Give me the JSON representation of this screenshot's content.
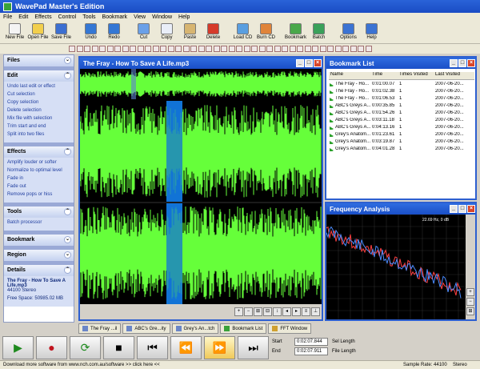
{
  "window": {
    "title": "WavePad Master's Edition"
  },
  "menu": [
    "File",
    "Edit",
    "Effects",
    "Control",
    "Tools",
    "Bookmark",
    "View",
    "Window",
    "Help"
  ],
  "toolbar": [
    {
      "label": "New File",
      "icon": "new-file-icon",
      "color": "#f4f4f4"
    },
    {
      "label": "Open File",
      "icon": "open-folder-icon",
      "color": "#f2cf4d"
    },
    {
      "label": "Save File",
      "icon": "save-disk-icon",
      "color": "#3c6fd1"
    },
    {
      "label": "Undo",
      "icon": "undo-icon",
      "color": "#3477d4"
    },
    {
      "label": "Redo",
      "icon": "redo-icon",
      "color": "#3477d4"
    },
    {
      "label": "Cut",
      "icon": "scissors-icon",
      "color": "#6aa0e8"
    },
    {
      "label": "Copy",
      "icon": "copy-icon",
      "color": "#e9eef8"
    },
    {
      "label": "Paste",
      "icon": "paste-icon",
      "color": "#d7b571"
    },
    {
      "label": "Delete",
      "icon": "delete-x-icon",
      "color": "#d63b2a"
    },
    {
      "label": "Load CD",
      "icon": "load-cd-icon",
      "color": "#5a9fe0"
    },
    {
      "label": "Burn CD",
      "icon": "burn-cd-icon",
      "color": "#e0843a"
    },
    {
      "label": "Bookmark",
      "icon": "bookmark-icon",
      "color": "#4aa84a"
    },
    {
      "label": "Batch",
      "icon": "batch-icon",
      "color": "#3aa15a"
    },
    {
      "label": "Options",
      "icon": "options-gear-icon",
      "color": "#3b73d3"
    },
    {
      "label": "Help",
      "icon": "help-icon",
      "color": "#3b73d3"
    }
  ],
  "sidebar": {
    "files": {
      "title": "Files"
    },
    "edit": {
      "title": "Edit",
      "items": [
        "Undo last edit or effect",
        "Cut selection",
        "Copy selection",
        "Delete selection",
        "Mix file with selection",
        "Trim start and end",
        "Split into two files"
      ]
    },
    "effects": {
      "title": "Effects",
      "items": [
        "Amplify louder or softer",
        "Normalize to optimal level",
        "Fade in",
        "Fade out",
        "Remove pops or hiss"
      ]
    },
    "tools": {
      "title": "Tools",
      "items": [
        "Batch processor"
      ]
    },
    "bookmark": {
      "title": "Bookmark"
    },
    "region": {
      "title": "Region"
    },
    "details": {
      "title": "Details",
      "name": "The Fray - How To Save A Life.mp3",
      "format": "44100 Stereo",
      "free": "Free Space: 50985.02 MB"
    }
  },
  "wave_window": {
    "title": "The Fray - How To Save A Life.mp3",
    "wave_color": "#66ff3a",
    "selection_color": "#1273d6"
  },
  "bookmark_list": {
    "title": "Bookmark List",
    "columns": [
      "Name",
      "Time",
      "Times Visited",
      "Last Visited"
    ],
    "rows": [
      [
        "The Fray - Ho...",
        "0:01:00.07",
        "1",
        "2007-06-20..."
      ],
      [
        "The Fray - Ho...",
        "0:01:02.38",
        "1",
        "2007-06-20..."
      ],
      [
        "The Fray - Ho...",
        "0:01:06.53",
        "1",
        "2007-06-20..."
      ],
      [
        "ABC's Greys A...",
        "0:00:35.85",
        "1",
        "2007-06-20..."
      ],
      [
        "ABC's Greys A...",
        "0:01:54.26",
        "1",
        "2007-06-20..."
      ],
      [
        "ABC's Greys A...",
        "0:03:11.18",
        "1",
        "2007-06-20..."
      ],
      [
        "ABC's Greys A...",
        "0:04:13.16",
        "1",
        "2007-06-20..."
      ],
      [
        "Grey's Anatom...",
        "0:01:23.61",
        "1",
        "2007-06-20..."
      ],
      [
        "Grey's Anatom...",
        "0:03:19.87",
        "1",
        "2007-06-20..."
      ],
      [
        "Grey's Anatom...",
        "0:04:01.28",
        "1",
        "2007-06-20..."
      ]
    ]
  },
  "frequency": {
    "title": "Frequency Analysis",
    "readout": "22.69 Hz, 0 dB"
  },
  "tabs": [
    "The Fray ...il",
    "ABC's Gre...ity",
    "Grey's An...tch",
    "Bookmark List",
    "FFT Window"
  ],
  "transport": [
    "play",
    "record",
    "loop",
    "stop",
    "skip-start",
    "rewind",
    "fast-forward",
    "skip-end"
  ],
  "time": {
    "start_label": "Start",
    "start": "0:02:07.844",
    "end_label": "End",
    "end": "0:02:07.911",
    "sel_label": "Sel Length",
    "file_label": "File Length"
  },
  "status": {
    "left": "Download more software from www.nch.com.au/software >> click here <<",
    "sample": "Sample Rate: 44100",
    "mode": "Stereo"
  }
}
